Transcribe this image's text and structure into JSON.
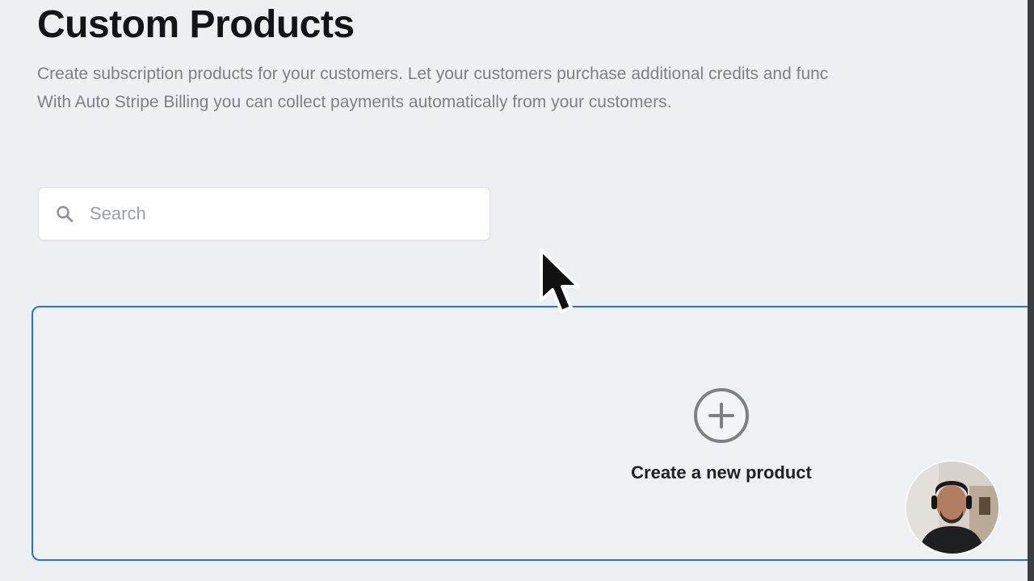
{
  "page": {
    "title": "Custom Products",
    "description_line1": "Create subscription products for your customers. Let your customers purchase additional credits and func",
    "description_line2": "With Auto Stripe Billing you can collect payments automatically from your customers."
  },
  "search": {
    "placeholder": "Search",
    "icon": "search-icon"
  },
  "create_card": {
    "label": "Create a new product",
    "icon": "plus-circle-icon",
    "accent_color": "#2f6fd0"
  },
  "overlay": {
    "cursor_icon": "mouse-pointer-icon",
    "webcam": "presenter-webcam"
  }
}
